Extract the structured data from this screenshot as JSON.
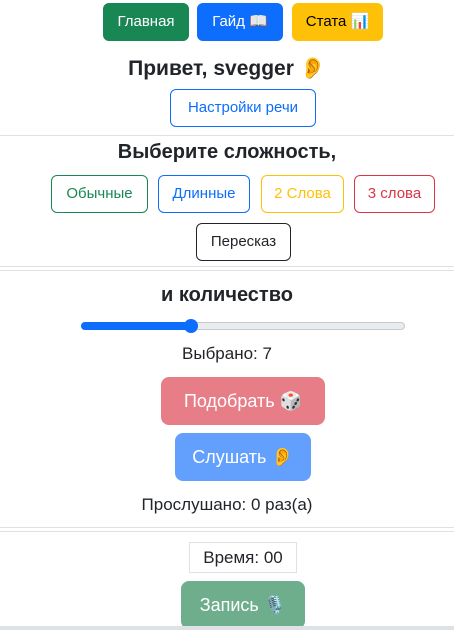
{
  "nav": {
    "home": "Главная",
    "guide": "Гайд 📖",
    "stats": "Стата 📊"
  },
  "greeting": "Привет, svegger 👂",
  "speech_settings": "Настройки речи",
  "difficulty": {
    "title": "Выберите сложность,",
    "options": [
      "Обычные",
      "Длинные",
      "2 Слова",
      "3 слова",
      "Пересказ"
    ]
  },
  "count": {
    "title": "и количество",
    "slider_fraction": 0.34,
    "selected": "Выбрано: 7"
  },
  "actions": {
    "pick": "Подобрать 🎲",
    "listen": "Слушать 👂"
  },
  "listened": "Прослушано: 0 раз(а)",
  "timer": "Время: 00",
  "record": "Запись 🎙️"
}
